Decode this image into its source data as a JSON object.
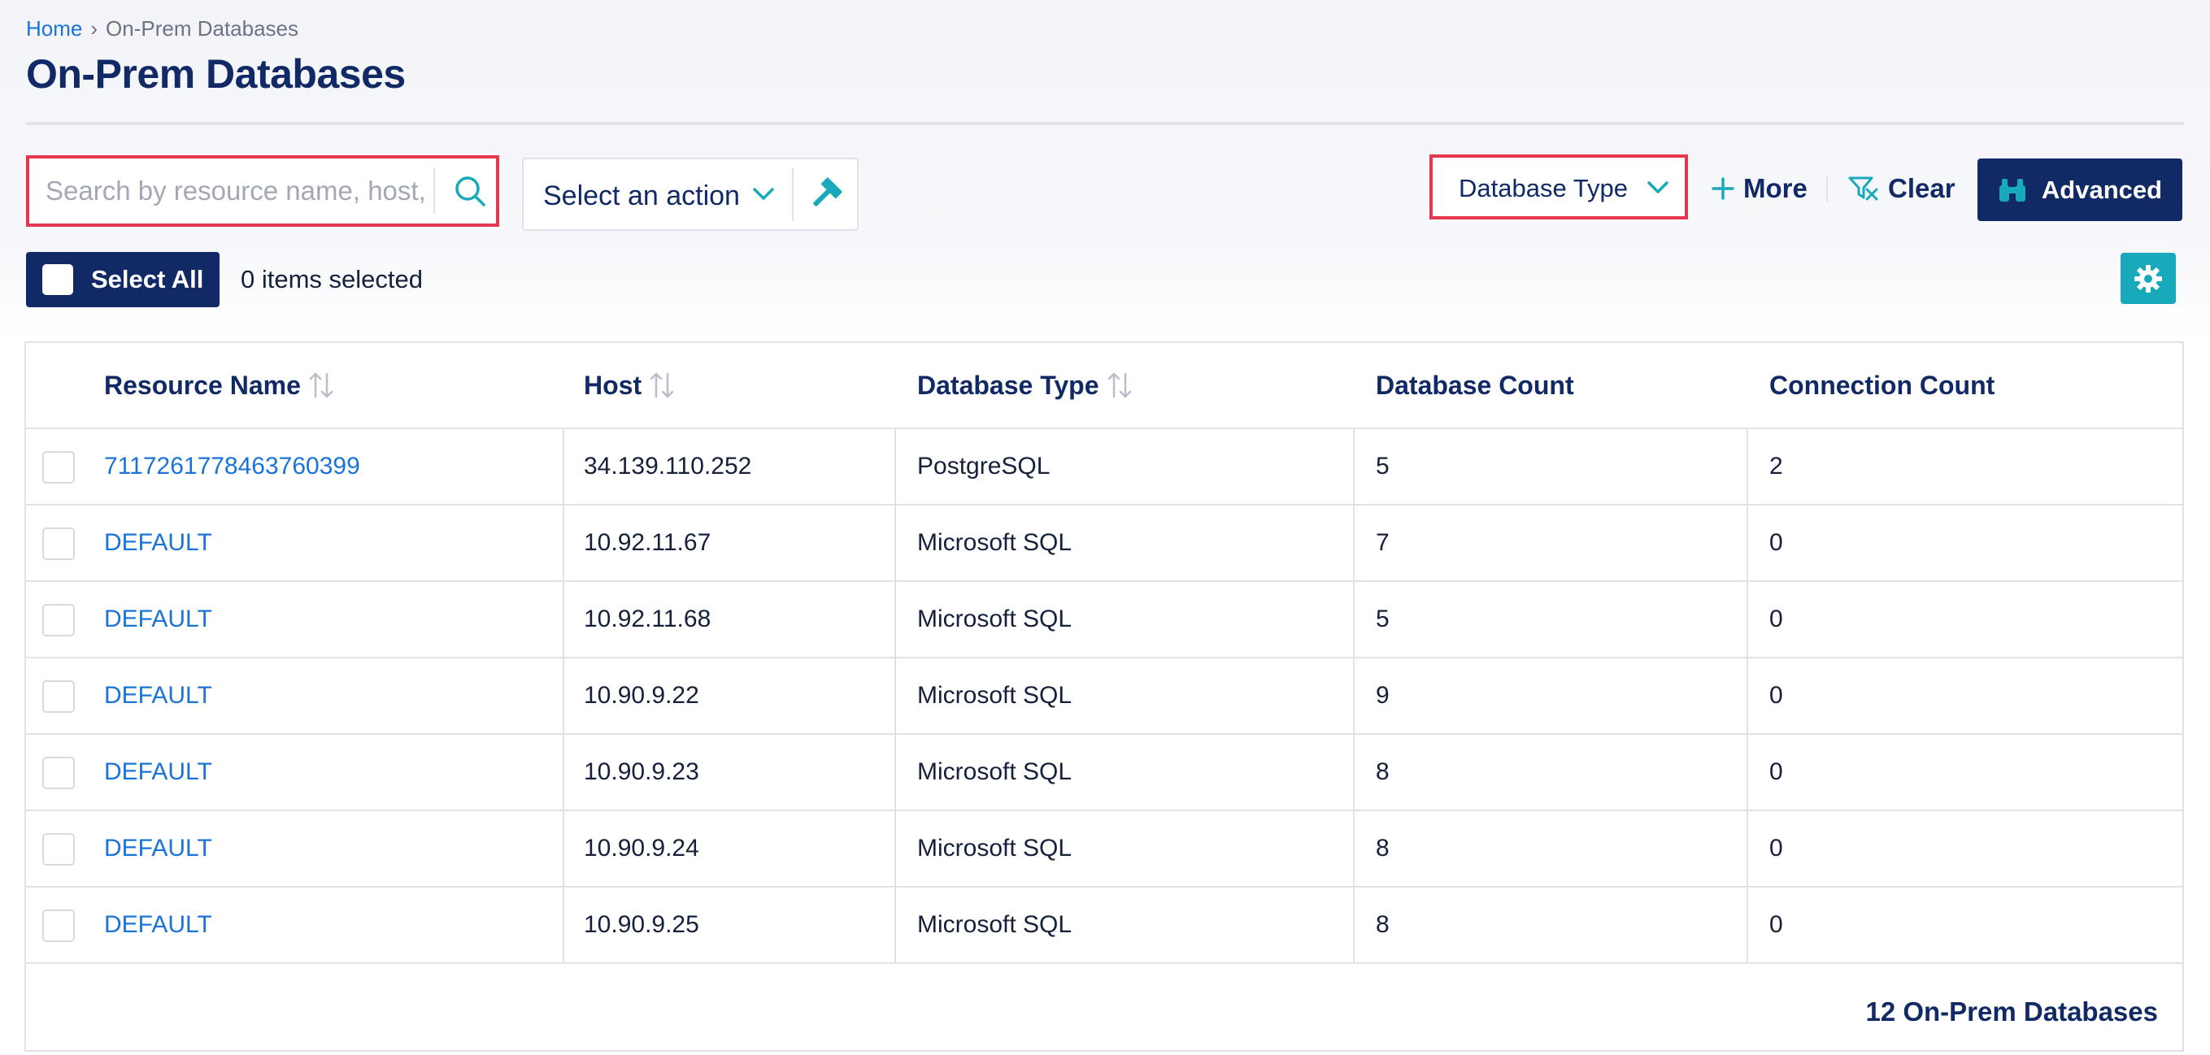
{
  "breadcrumb": {
    "home": "Home",
    "separator": "›",
    "current": "On-Prem Databases"
  },
  "page_title": "On-Prem Databases",
  "toolbar": {
    "search_placeholder": "Search by resource name, host, or database type",
    "search_value": "",
    "action_label": "Select an action",
    "database_type_filter": "Database Type",
    "more_label": "More",
    "clear_label": "Clear",
    "advanced_label": "Advanced",
    "select_all_label": "Select All",
    "selected_count": "0 items selected"
  },
  "icons": {
    "search": "search-icon",
    "action_chevron": "chevron-down-icon",
    "action_tool": "hammer-icon",
    "filter_chevron": "chevron-down-icon",
    "more": "plus-icon",
    "clear": "clear-filter-icon",
    "advanced": "binoculars-icon",
    "settings": "gear-icon",
    "sort": "sort-arrows-icon"
  },
  "colors": {
    "navy": "#112a66",
    "link": "#1a73d9",
    "teal": "#18a9bb",
    "highlight": "#e5384f",
    "border": "#dfe2e8"
  },
  "table": {
    "columns": [
      {
        "label": "Resource Name",
        "sortable": true
      },
      {
        "label": "Host",
        "sortable": true
      },
      {
        "label": "Database Type",
        "sortable": true
      },
      {
        "label": "Database Count",
        "sortable": false
      },
      {
        "label": "Connection Count",
        "sortable": false
      }
    ],
    "rows": [
      {
        "resource": "7117261778463760399",
        "host": "34.139.110.252",
        "type": "PostgreSQL",
        "db_count": "5",
        "conn_count": "2"
      },
      {
        "resource": "DEFAULT",
        "host": "10.92.11.67",
        "type": "Microsoft SQL",
        "db_count": "7",
        "conn_count": "0"
      },
      {
        "resource": "DEFAULT",
        "host": "10.92.11.68",
        "type": "Microsoft SQL",
        "db_count": "5",
        "conn_count": "0"
      },
      {
        "resource": "DEFAULT",
        "host": "10.90.9.22",
        "type": "Microsoft SQL",
        "db_count": "9",
        "conn_count": "0"
      },
      {
        "resource": "DEFAULT",
        "host": "10.90.9.23",
        "type": "Microsoft SQL",
        "db_count": "8",
        "conn_count": "0"
      },
      {
        "resource": "DEFAULT",
        "host": "10.90.9.24",
        "type": "Microsoft SQL",
        "db_count": "8",
        "conn_count": "0"
      },
      {
        "resource": "DEFAULT",
        "host": "10.90.9.25",
        "type": "Microsoft SQL",
        "db_count": "8",
        "conn_count": "0"
      }
    ],
    "footer": "12 On-Prem Databases"
  }
}
